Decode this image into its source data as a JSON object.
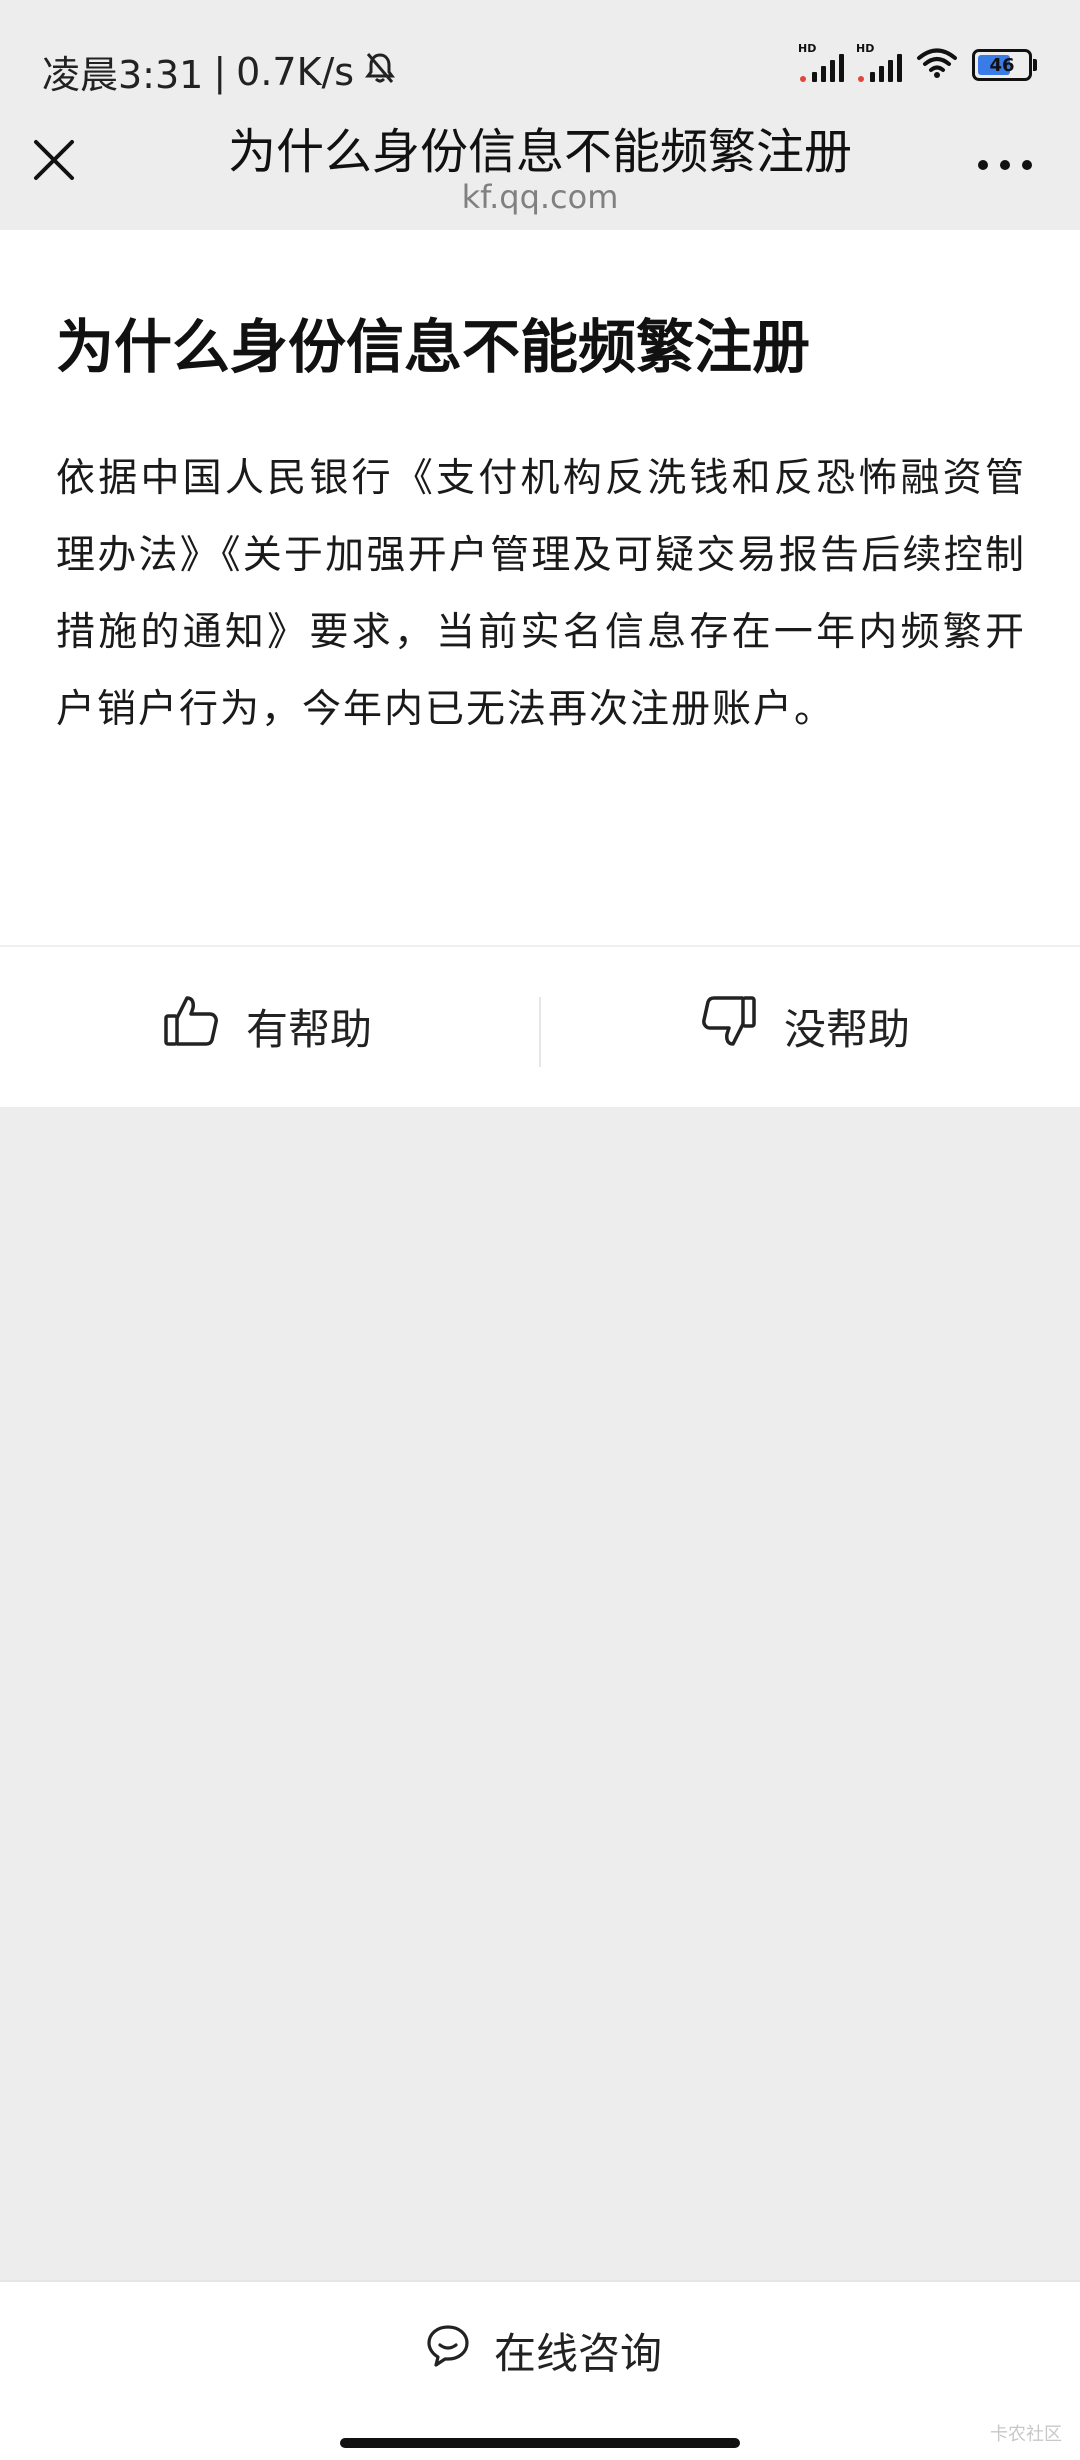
{
  "status_bar": {
    "time": "凌晨3:31",
    "separator": "|",
    "network_speed": "0.7K/s",
    "mute_icon": "bell-off-icon",
    "sim1_label": "HD",
    "sim2_label": "HD",
    "wifi_icon": "wifi-icon",
    "battery_level": "46"
  },
  "nav": {
    "title": "为什么身份信息不能频繁注册",
    "subtitle": "kf.qq.com",
    "close_icon": "close-icon",
    "more_icon": "more-icon"
  },
  "article": {
    "title": "为什么身份信息不能频繁注册",
    "body": "依据中国人民银行《支付机构反洗钱和反恐怖融资管理办法》《关于加强开户管理及可疑交易报告后续控制措施的通知》要求，当前实名信息存在一年内频繁开户销户行为，今年内已无法再次注册账户。"
  },
  "feedback": {
    "helpful_label": "有帮助",
    "not_helpful_label": "没帮助"
  },
  "consult": {
    "label": "在线咨询"
  },
  "watermark": "卡农社区",
  "colors": {
    "background": "#ededed",
    "card": "#ffffff",
    "text": "#1a1a1a",
    "subtitle": "#808080",
    "battery_fill": "#3a7be8",
    "signal_dot": "#e0463c"
  }
}
